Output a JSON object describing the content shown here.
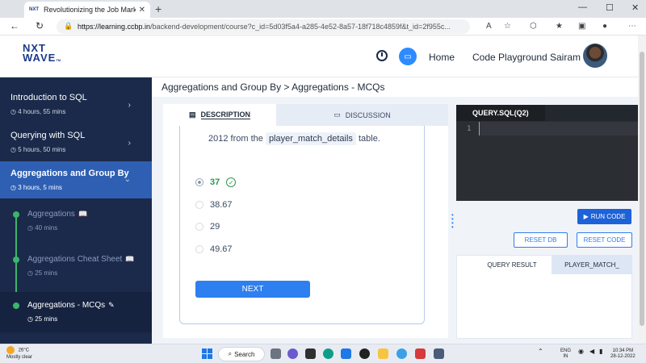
{
  "browser": {
    "tab_title": "Revolutionizing the Job Market |",
    "favicon_text": "NXT",
    "url_host": "https://learning.ccbp.in",
    "url_path": "/backend-development/course?c_id=5d03f5a4-a285-4e52-8a57-18f718c4859f&t_id=2f955c...",
    "new_tab": "+",
    "tab_close": "✕",
    "minimize": "—",
    "maximize": "☐",
    "close": "✕",
    "back": "←",
    "refresh": "↻",
    "lock": "🔒"
  },
  "header": {
    "logo_top": "NXT",
    "logo_bottom": "WAVE",
    "logo_tm": "TM",
    "nav_home": "Home",
    "nav_playground": "Code Playground",
    "user_name": "Sairam"
  },
  "sidebar": {
    "modules": [
      {
        "title": "Introduction to SQL",
        "duration": "4 hours, 55 mins"
      },
      {
        "title": "Querying with SQL",
        "duration": "5 hours, 50 mins"
      },
      {
        "title": "Aggregations and Group By",
        "duration": "3 hours, 5 mins"
      }
    ],
    "sub_items": [
      {
        "title": "Aggregations",
        "duration": "40 mins"
      },
      {
        "title": "Aggregations Cheat Sheet",
        "duration": "25 mins"
      },
      {
        "title": "Aggregations - MCQs",
        "duration": "25 mins"
      }
    ]
  },
  "main": {
    "breadcrumb": "Aggregations and Group By > Aggregations - MCQs",
    "tab_description": "DESCRIPTION",
    "tab_discussion": "DISCUSSION",
    "question_prefix": "2012 from the",
    "question_code": "player_match_details",
    "question_suffix": "table.",
    "options": [
      "37",
      "38.67",
      "29",
      "49.67"
    ],
    "selected_option": "37",
    "next_label": "NEXT"
  },
  "editor": {
    "tab_label": "QUERY.SQL(Q2)",
    "line_number": "1",
    "run_label": "RUN CODE",
    "reset_db_label": "RESET DB",
    "reset_code_label": "RESET CODE",
    "result_tab": "QUERY RESULT",
    "table_tab": "PLAYER_MATCH_"
  },
  "taskbar": {
    "temperature": "26°C",
    "weather": "Mostly clear",
    "search": "Search",
    "lang_top": "ENG",
    "lang_bottom": "IN",
    "time": "10:34 PM",
    "date": "28-12-2022"
  },
  "colors": {
    "sidebar_bg": "#1b2a4a",
    "active_module": "#2e5fb3",
    "primary_button": "#2e7ff0",
    "correct_green": "#2c9a4b"
  }
}
